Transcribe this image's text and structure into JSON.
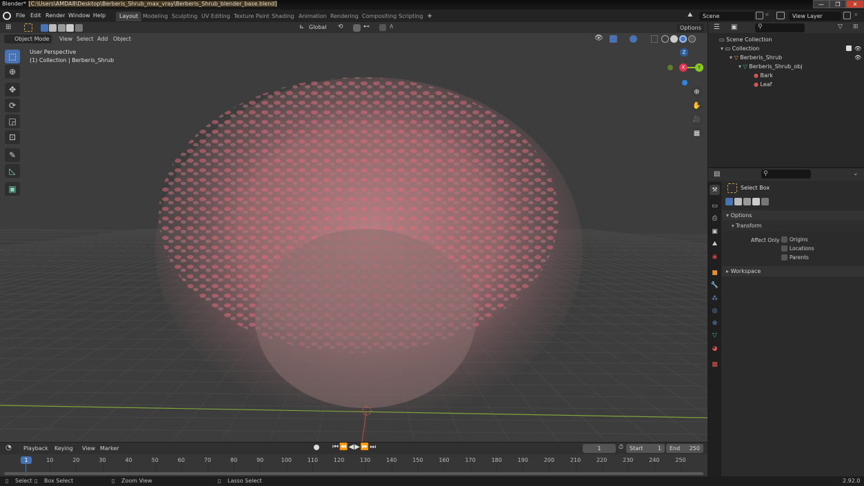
{
  "window": {
    "app": "Blender*",
    "path": "[C:\\Users\\AMDA8\\Desktop\\Berberis_Shrub_max_vray\\Berberis_Shrub_blender_base.blend]",
    "controls": {
      "minimize": "—",
      "maximize": "❐",
      "close": "✕"
    }
  },
  "menu": {
    "items": [
      "File",
      "Edit",
      "Render",
      "Window",
      "Help"
    ]
  },
  "workspaces": {
    "tabs": [
      "Layout",
      "Modeling",
      "Sculpting",
      "UV Editing",
      "Texture Paint",
      "Shading",
      "Animation",
      "Rendering",
      "Compositing",
      "Scripting"
    ],
    "active": "Layout",
    "add": "+"
  },
  "scene": {
    "name": "Scene",
    "view_layer": "View Layer"
  },
  "viewport": {
    "header": {
      "mode": "Object Mode",
      "menus": [
        "View",
        "Select",
        "Add",
        "Object"
      ],
      "orientation": "Global",
      "options": "Options"
    },
    "overlay_text": {
      "line1": "User Perspective",
      "line2": "(1) Collection | Berberis_Shrub"
    },
    "gizmo": {
      "x": "X",
      "y": "Y",
      "z": "Z"
    },
    "colors": {
      "x_axis": "#e8344e",
      "y_axis": "#8acb1f",
      "z_axis": "#2f83e4",
      "grid": "#4a4a4a",
      "foliage": "#d66b78"
    }
  },
  "toolbar": {
    "tools": [
      "select-box",
      "cursor",
      "move",
      "rotate",
      "scale",
      "transform",
      "annotate",
      "measure",
      "add-cube"
    ],
    "active": "select-box"
  },
  "outliner": {
    "search_placeholder": "",
    "root": "Scene Collection",
    "items": [
      {
        "label": "Collection",
        "level": 1,
        "icon": "collection-icon"
      },
      {
        "label": "Berberis_Shrub",
        "level": 2,
        "icon": "empty-object-icon"
      },
      {
        "label": "Berberis_Shrub_obj",
        "level": 3,
        "icon": "mesh-data-icon"
      },
      {
        "label": "Bark",
        "level": 4,
        "icon": "material-icon"
      },
      {
        "label": "Leaf",
        "level": 4,
        "icon": "material-icon"
      }
    ]
  },
  "properties": {
    "tool_name": "Select Box",
    "options_label": "Options",
    "transform_label": "Transform",
    "affect_only_label": "Affect Only",
    "checkboxes": [
      {
        "label": "Origins",
        "checked": false
      },
      {
        "label": "Locations",
        "checked": false
      },
      {
        "label": "Parents",
        "checked": false
      }
    ],
    "workspace_label": "Workspace"
  },
  "timeline": {
    "menus": [
      "Playback",
      "Keying",
      "View",
      "Marker"
    ],
    "current_frame": "1",
    "start_label": "Start",
    "start": "1",
    "end_label": "End",
    "end": "250",
    "ticks": [
      "10",
      "20",
      "30",
      "40",
      "50",
      "60",
      "70",
      "80",
      "90",
      "100",
      "110",
      "120",
      "130",
      "140",
      "150",
      "160",
      "170",
      "180",
      "190",
      "200",
      "210",
      "220",
      "230",
      "240",
      "250"
    ],
    "playhead": "1"
  },
  "statusbar": {
    "items": [
      "Select",
      "Box Select",
      "Zoom View",
      "Lasso Select"
    ],
    "version": "2.92.0"
  }
}
